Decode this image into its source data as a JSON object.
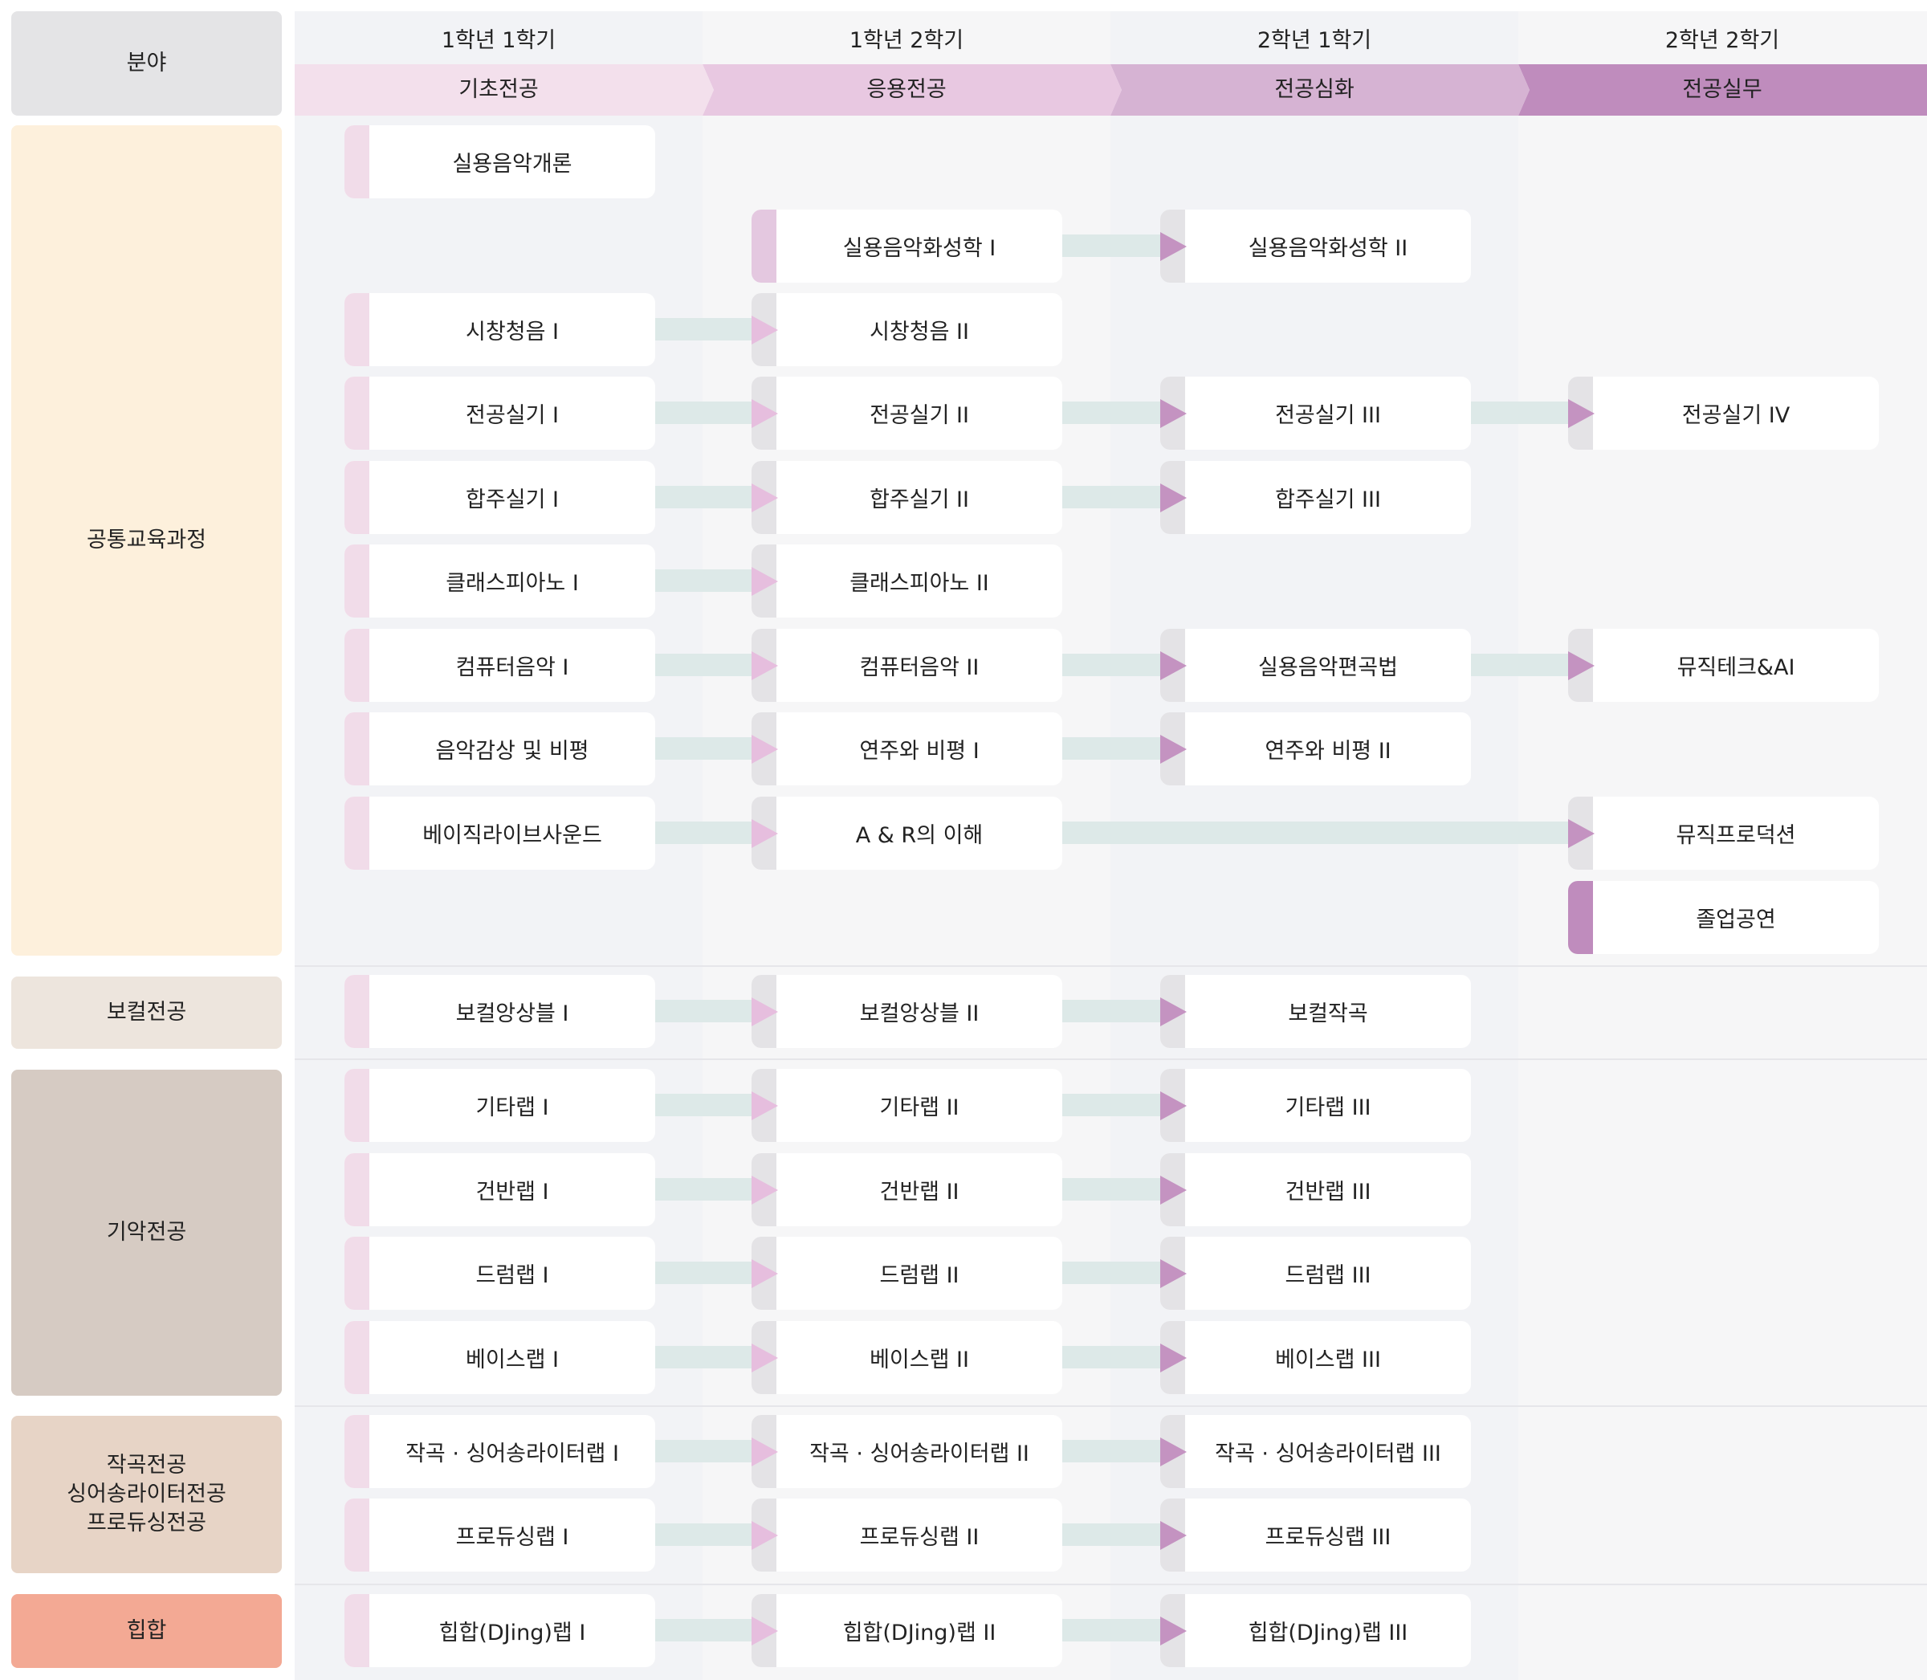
{
  "header": {
    "category_label": "분야",
    "semesters": [
      "1학년 1학기",
      "1학년 2학기",
      "2학년 1학기",
      "2학년 2학기"
    ],
    "stages": [
      "기초전공",
      "응용전공",
      "전공심화",
      "전공실무"
    ]
  },
  "colors": {
    "stage_bars": [
      "#f3e0ec",
      "#e8c8e1",
      "#d6b3d3",
      "#bf8cbd"
    ],
    "connector": "#dde9e8",
    "arrow_light": "#e6bede",
    "arrow_dark": "#c493c1"
  },
  "categories": [
    {
      "label": "공통교육과정",
      "color": "#fdf0dc"
    },
    {
      "label": "보컬전공",
      "color": "#ede5dd"
    },
    {
      "label": "기악전공",
      "color": "#d6cbc3"
    },
    {
      "label": "작곡전공\n싱어송라이터전공\n프로듀싱전공",
      "color": "#e7d4c6"
    },
    {
      "label": "힙합",
      "color": "#f3a994"
    }
  ],
  "rows": [
    [
      "실용음악개론",
      "",
      "",
      ""
    ],
    [
      "",
      "실용음악화성학 I",
      "실용음악화성학 II",
      ""
    ],
    [
      "시창청음 I",
      "시창청음 II",
      "",
      ""
    ],
    [
      "전공실기 I",
      "전공실기 II",
      "전공실기 III",
      "전공실기 IV"
    ],
    [
      "합주실기 I",
      "합주실기 II",
      "합주실기 III",
      ""
    ],
    [
      "클래스피아노 I",
      "클래스피아노 II",
      "",
      ""
    ],
    [
      "컴퓨터음악 I",
      "컴퓨터음악 II",
      "실용음악편곡법",
      "뮤직테크&AI"
    ],
    [
      "음악감상 및 비평",
      "연주와 비평 I",
      "연주와 비평 II",
      ""
    ],
    [
      "베이직라이브사운드",
      "A & R의 이해",
      "",
      "뮤직프로덕션"
    ],
    [
      "",
      "",
      "",
      "졸업공연"
    ],
    [
      "보컬앙상블 I",
      "보컬앙상블 II",
      "보컬작곡",
      ""
    ],
    [
      "기타랩 I",
      "기타랩 II",
      "기타랩 III",
      ""
    ],
    [
      "건반랩 I",
      "건반랩 II",
      "건반랩 III",
      ""
    ],
    [
      "드럼랩 I",
      "드럼랩 II",
      "드럼랩 III",
      ""
    ],
    [
      "베이스랩 I",
      "베이스랩 II",
      "베이스랩 III",
      ""
    ],
    [
      "작곡 · 싱어송라이터랩 I",
      "작곡 · 싱어송라이터랩 II",
      "작곡 · 싱어송라이터랩 III",
      ""
    ],
    [
      "프로듀싱랩 I",
      "프로듀싱랩 II",
      "프로듀싱랩 III",
      ""
    ],
    [
      "힙합(DJing)랩 I",
      "힙합(DJing)랩 II",
      "힙합(DJing)랩 III",
      ""
    ]
  ]
}
